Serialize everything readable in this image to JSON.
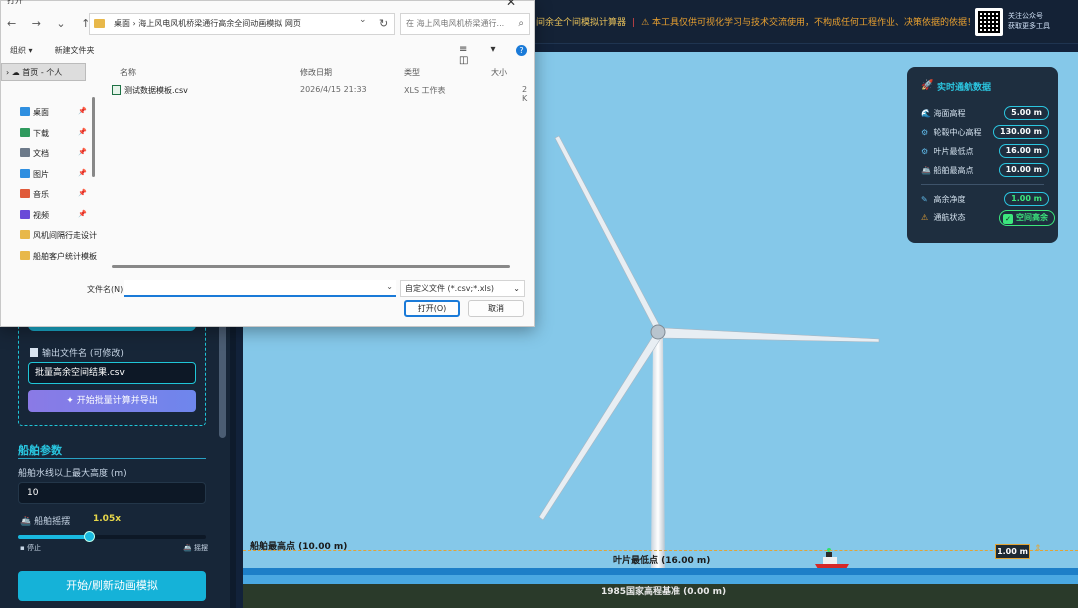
{
  "banner": {
    "text1": "间余全个间模拟计算器",
    "warning": "本工具仅供可视化学习与技术交流使用，不构成任何工程作业、决策依据的依据！"
  },
  "qr": {
    "line1": "关注公众号",
    "line2": "获取更多工具"
  },
  "dialog": {
    "title": "打开",
    "close": "✕",
    "nav_glyphs": "← → ⌄ ↑",
    "path": "桌面 › 海上风电风机桥梁通行高余全间动画模拟 网页",
    "path_dropdown": "⌄",
    "refresh": "↻",
    "search_placeholder": "在 海上风电风机桥梁通行...",
    "toolbar": {
      "organize": "组织 ▾",
      "new_folder": "新建文件夹"
    },
    "view_icons": "≡ ▾ ◫",
    "help": "?",
    "nav_selected": "› ☁ 首页 - 个人",
    "nav_items": [
      {
        "label": "桌面",
        "color": "#2f8fe0",
        "pin": true
      },
      {
        "label": "下载",
        "color": "#2f9a5e",
        "pin": true
      },
      {
        "label": "文档",
        "color": "#6d7a8a",
        "pin": true
      },
      {
        "label": "图片",
        "color": "#2f8fe0",
        "pin": true
      },
      {
        "label": "音乐",
        "color": "#e05a3a",
        "pin": true
      },
      {
        "label": "视频",
        "color": "#6a4ad8",
        "pin": true
      },
      {
        "label": "风机间隔行走设计",
        "color": "#e8b84a",
        "pin": false
      },
      {
        "label": "船舶客户统计模板",
        "color": "#e8b84a",
        "pin": false
      }
    ],
    "columns": [
      "名称",
      "修改日期",
      "类型",
      "大小"
    ],
    "file": {
      "name": "测试数据模板.csv",
      "date": "2026/4/15 21:33",
      "type": "XLS 工作表",
      "size": "2 K"
    },
    "filename_label": "文件名(N):",
    "filetype": "自定义文件 (*.csv;*.xls)",
    "open_btn": "打开(O)",
    "cancel_btn": "取消"
  },
  "left": {
    "output_label": "输出文件名 (可修改)",
    "output_value": "批量高余空间结果.csv",
    "batch_btn": "✦ 开始批量计算并导出",
    "ship_section": "船舶参数",
    "height_label": "船舶水线以上最大高度 (m)",
    "height_value": "10",
    "sway_label": "🚢 船舶摇摆",
    "sway_value": "1.05x",
    "sway_fraction": 0.38,
    "sway_min": "▪ 停止",
    "sway_max": "🚢 摇摆",
    "start_btn": "开始/刷新动画模拟"
  },
  "scene": {
    "ship_label": "船舶最高点 (10.00 m)",
    "blade_label": "叶片最低点 (16.00 m)",
    "datum_label": "1985国家高程基准 (0.00 m)",
    "clearance_tag": "1.00 m",
    "clearance_tick": "⇕"
  },
  "panel": {
    "title_icon": "🚀",
    "title": "实时通航数据",
    "rows": [
      {
        "icon": "🌊",
        "label": "海面高程",
        "value": "5.00 m",
        "green": false
      },
      {
        "icon": "⚙",
        "label": "轮毂中心高程",
        "value": "130.00 m",
        "green": false
      },
      {
        "icon": "⚙",
        "label": "叶片最低点",
        "value": "16.00 m",
        "green": false
      },
      {
        "icon": "🚢",
        "label": "船舶最高点",
        "value": "10.00 m",
        "green": false
      },
      {
        "icon": "✎",
        "label": "高余净度",
        "value": "1.00 m",
        "green": true
      }
    ],
    "status_icon": "⚠",
    "status_label": "通航状态",
    "status_check": "✓",
    "status_value": "空间高余"
  },
  "colors": {
    "accent": "#29c6e0",
    "sky": "#85c8e9",
    "sea": "#1d7fc8",
    "warning": "#e2a436",
    "ok": "#3ae87a"
  }
}
